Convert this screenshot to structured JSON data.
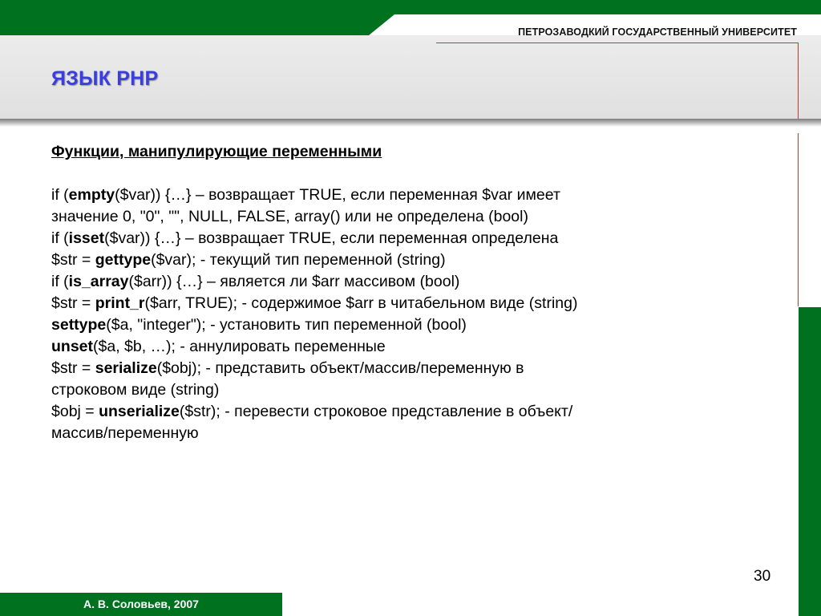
{
  "header": {
    "university": "ПЕТРОЗАВОДКИЙ ГОСУДАРСТВЕННЫЙ УНИВЕРСИТЕТ",
    "title": "ЯЗЫК PHP"
  },
  "content": {
    "subtitle": "Функции, манипулирующие переменными",
    "lines": [
      [
        {
          "t": "if ("
        },
        {
          "t": "empty",
          "b": true
        },
        {
          "t": "($var)) {…} – возвращает TRUE, если переменная $var имеет"
        }
      ],
      [
        {
          "t": "значение 0, \"0\", \"\", NULL, FALSE, array() или не определена (bool)"
        }
      ],
      [
        {
          "t": "if ("
        },
        {
          "t": "isset",
          "b": true
        },
        {
          "t": "($var)) {…} – возвращает TRUE, если переменная определена"
        }
      ],
      [
        {
          "t": "$str = "
        },
        {
          "t": "gettype",
          "b": true
        },
        {
          "t": "($var); - текущий тип переменной (string)"
        }
      ],
      [
        {
          "t": "if ("
        },
        {
          "t": "is_array",
          "b": true
        },
        {
          "t": "($arr)) {…} – является ли $arr массивом (bool)"
        }
      ],
      [
        {
          "t": "$str = "
        },
        {
          "t": "print_r",
          "b": true
        },
        {
          "t": "($arr, TRUE); - содержимое $arr в читабельном виде (string)"
        }
      ],
      [
        {
          "t": "settype",
          "b": true
        },
        {
          "t": "($a, \"integer\"); -  установить тип переменной (bool)"
        }
      ],
      [
        {
          "t": "unset",
          "b": true
        },
        {
          "t": "($a, $b, …); - аннулировать переменные"
        }
      ],
      [
        {
          "t": "$str = "
        },
        {
          "t": "serialize",
          "b": true
        },
        {
          "t": "($obj); - представить объект/массив/переменную в"
        }
      ],
      [
        {
          "t": "строковом виде (string)"
        }
      ],
      [
        {
          "t": "$obj = "
        },
        {
          "t": "unserialize",
          "b": true
        },
        {
          "t": "($str); - перевести строковое представление в объект/"
        }
      ],
      [
        {
          "t": "массив/переменную"
        }
      ]
    ]
  },
  "footer": {
    "author": "А. В. Соловьев, 2007",
    "page_number": "30"
  },
  "colors": {
    "green": "#00721f",
    "title_blue": "#3a3ee0",
    "accent_red": "#c0392b"
  }
}
